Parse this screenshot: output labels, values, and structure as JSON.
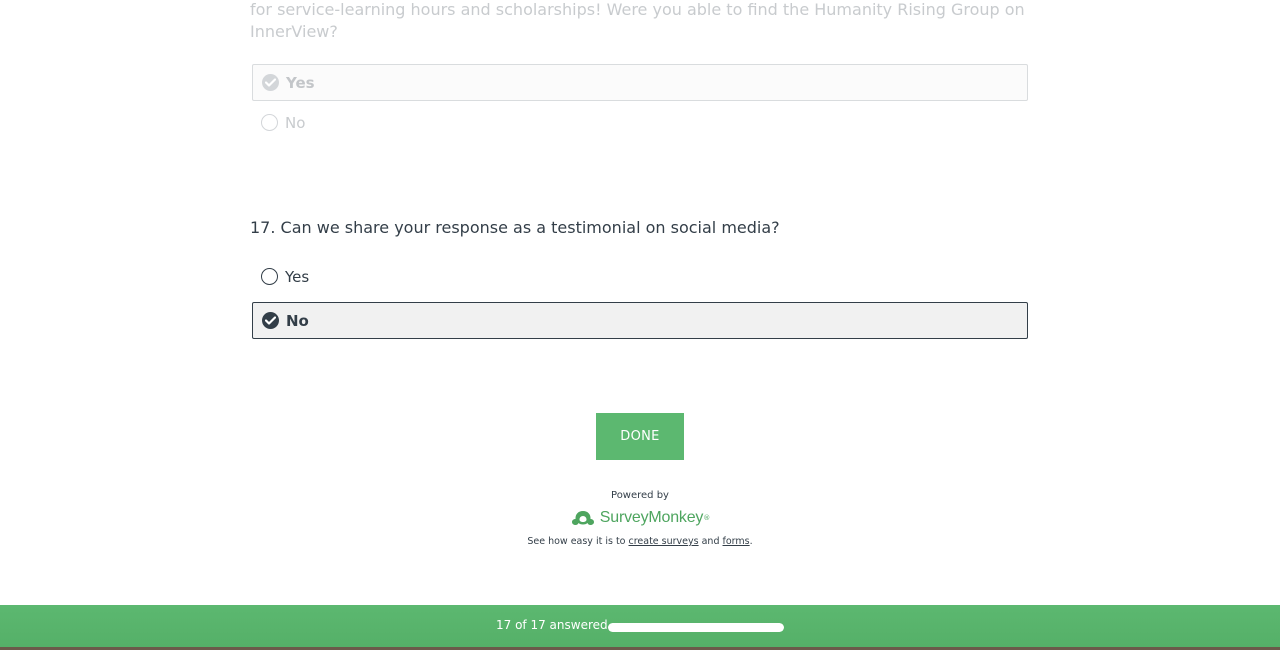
{
  "previous_question": {
    "text_tail": "for service-learning hours and scholarships! Were you able to find the Humanity Rising Group on InnerView?",
    "options": [
      {
        "label": "Yes",
        "selected": true
      },
      {
        "label": "No",
        "selected": false
      }
    ]
  },
  "question": {
    "title": "17. Can we share your response as a testimonial on social media?",
    "options": [
      {
        "label": "Yes",
        "selected": false
      },
      {
        "label": "No",
        "selected": true
      }
    ]
  },
  "done_button": {
    "label": "DONE"
  },
  "footer": {
    "powered_by": "Powered by",
    "brand": "SurveyMonkey",
    "tagline_prefix": "See how easy it is to ",
    "link_surveys": "create surveys",
    "tagline_middle": " and ",
    "link_forms": "forms",
    "tagline_suffix": "."
  },
  "progress": {
    "text": "17 of 17 answered",
    "answered": 17,
    "total": 17
  },
  "colors": {
    "accent_green": "#5cb870",
    "text_dark": "#333e48",
    "faded_text": "#c8cbce"
  }
}
